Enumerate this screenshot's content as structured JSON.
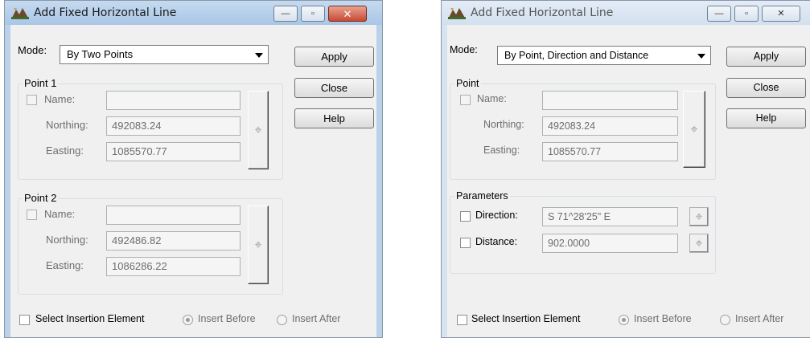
{
  "dialogs": [
    {
      "title": "Add Fixed Horizontal Line",
      "mode_label": "Mode:",
      "mode_value": "By Two Points",
      "buttons": {
        "apply": "Apply",
        "close": "Close",
        "help": "Help"
      },
      "groups": [
        {
          "title": "Point 1",
          "name_label": "Name:",
          "name_value": "",
          "northing_label": "Northing:",
          "northing_value": "492083.24",
          "easting_label": "Easting:",
          "easting_value": "1085570.77"
        },
        {
          "title": "Point 2",
          "name_label": "Name:",
          "name_value": "",
          "northing_label": "Northing:",
          "northing_value": "492486.82",
          "easting_label": "Easting:",
          "easting_value": "1086286.22"
        }
      ],
      "footer": {
        "select_insertion": "Select Insertion Element",
        "insert_before": "Insert Before",
        "insert_after": "Insert After"
      }
    },
    {
      "title": "Add Fixed Horizontal Line",
      "mode_label": "Mode:",
      "mode_value": "By Point, Direction and Distance",
      "buttons": {
        "apply": "Apply",
        "close": "Close",
        "help": "Help"
      },
      "point_group": {
        "title": "Point",
        "name_label": "Name:",
        "name_value": "",
        "northing_label": "Northing:",
        "northing_value": "492083.24",
        "easting_label": "Easting:",
        "easting_value": "1085570.77"
      },
      "parameters_group": {
        "title": "Parameters",
        "direction_label": "Direction:",
        "direction_value": "S 71^28'25\" E",
        "distance_label": "Distance:",
        "distance_value": "902.0000"
      },
      "footer": {
        "select_insertion": "Select Insertion Element",
        "insert_before": "Insert Before",
        "insert_after": "Insert After"
      }
    }
  ],
  "icons": {
    "pick_glyph": "⌖",
    "minimize": "—",
    "maximize": "▫",
    "close": "✕"
  }
}
